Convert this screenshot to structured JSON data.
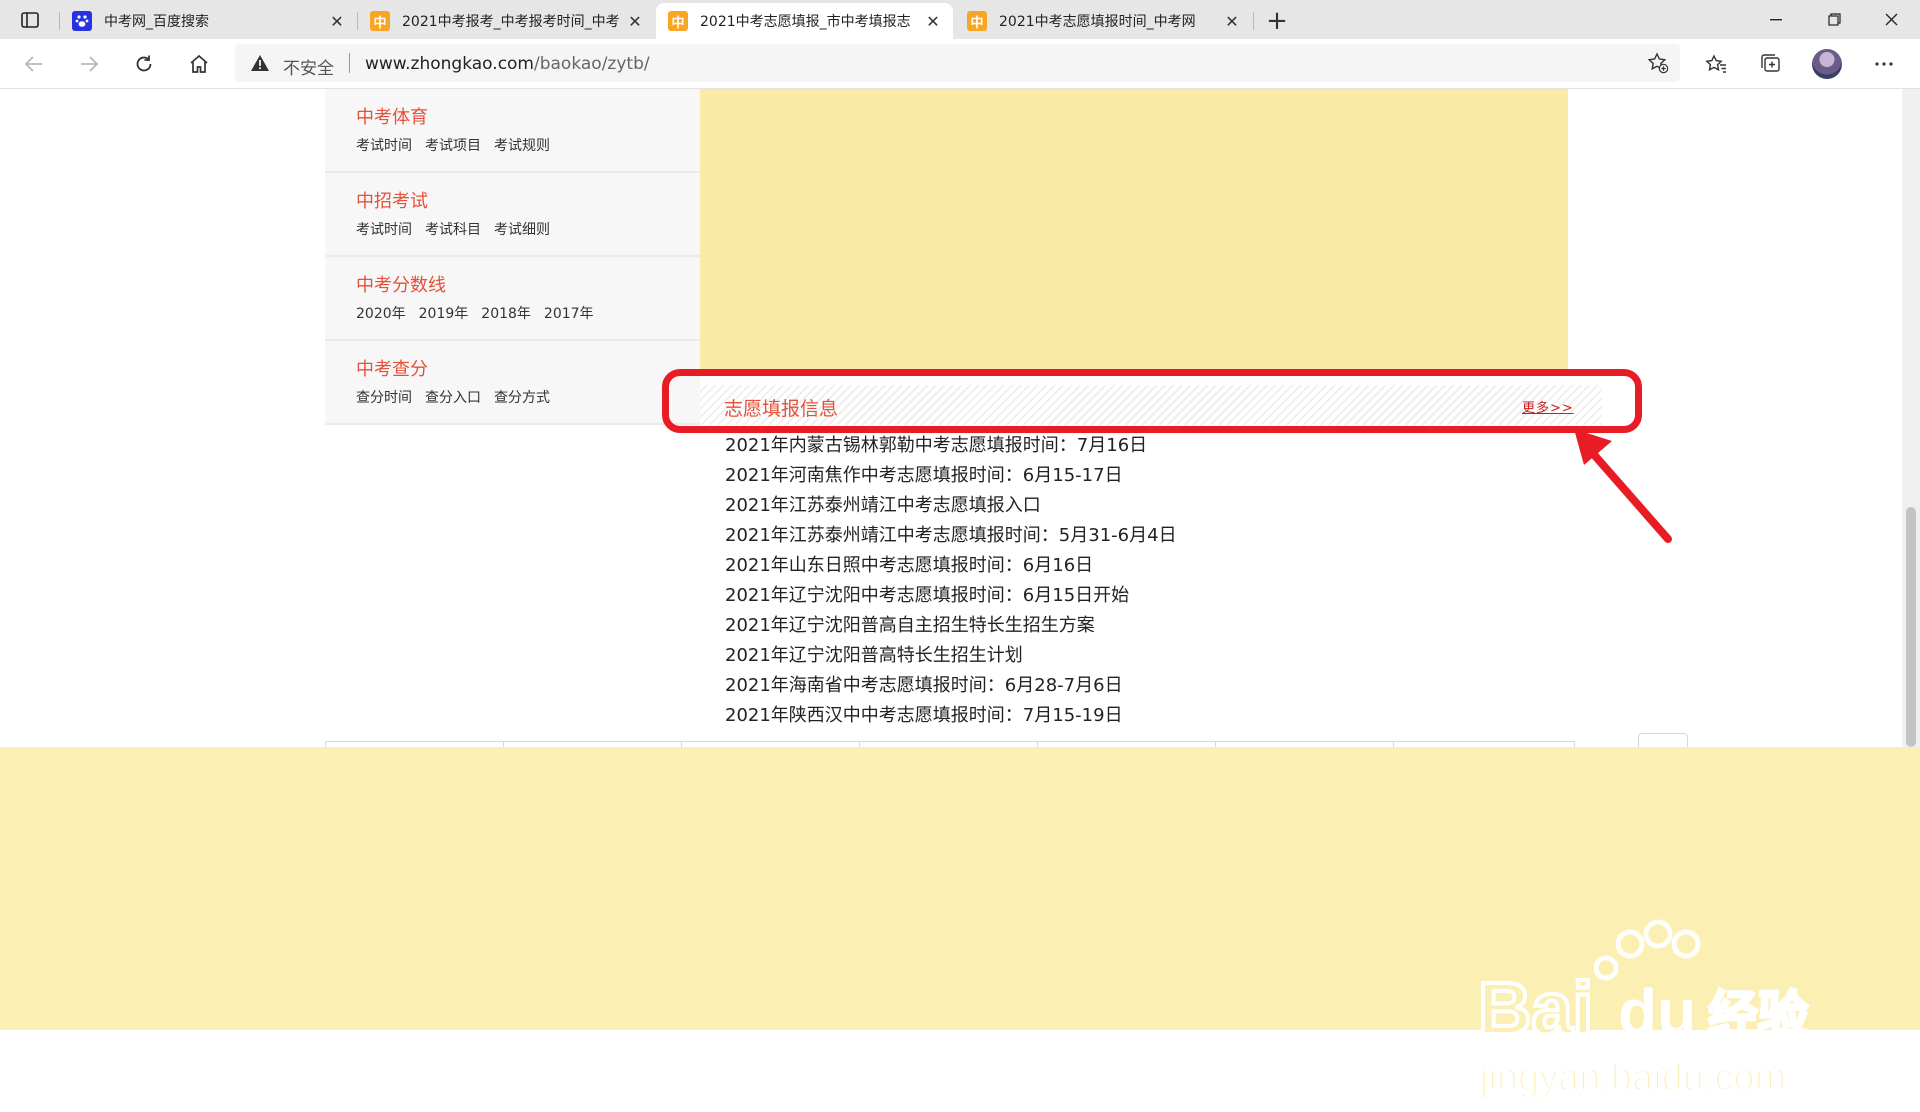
{
  "browser": {
    "tabs": [
      {
        "title": "中考网_百度搜索",
        "favicon": "baidu-paw-icon"
      },
      {
        "title": "2021中考报考_中考报考时间_中考",
        "favicon": "zhongkao-icon"
      },
      {
        "title": "2021中考志愿填报_市中考填报志",
        "favicon": "zhongkao-icon",
        "active": true
      },
      {
        "title": "2021中考志愿填报时间_中考网",
        "favicon": "zhongkao-icon"
      }
    ],
    "favicon_glyph": "中",
    "address": {
      "security_label": "不安全",
      "host": "www.zhongkao.com",
      "path": "/baokao/zytb/"
    }
  },
  "sidebar": {
    "items": [
      {
        "title": "中考体育",
        "links": [
          "考试时间",
          "考试项目",
          "考试规则"
        ]
      },
      {
        "title": "中招考试",
        "links": [
          "考试时间",
          "考试科目",
          "考试细则"
        ]
      },
      {
        "title": "中考分数线",
        "links": [
          "2020年",
          "2019年",
          "2018年",
          "2017年"
        ]
      },
      {
        "title": "中考查分",
        "links": [
          "查分时间",
          "查分入口",
          "查分方式"
        ]
      }
    ]
  },
  "info_section": {
    "title": "志愿填报信息",
    "more_label": "更多>>",
    "items": [
      "2021年内蒙古锡林郭勒中考志愿填报时间：7月16日",
      "2021年河南焦作中考志愿填报时间：6月15-17日",
      "2021年江苏泰州靖江中考志愿填报入口",
      "2021年江苏泰州靖江中考志愿填报时间：5月31-6月4日",
      "2021年山东日照中考志愿填报时间：6月16日",
      "2021年辽宁沈阳中考志愿填报时间：6月15日开始",
      "2021年辽宁沈阳普高自主招生特长生招生方案",
      "2021年辽宁沈阳普高特长生招生计划",
      "2021年海南省中考志愿填报时间：6月28-7月6日",
      "2021年陕西汉中中考志愿填报时间：7月15-19日"
    ]
  },
  "watermark": {
    "brand": "Bai",
    "brand_suffix": "du",
    "label": "经验",
    "url": "jingyan.baidu.com"
  },
  "colors": {
    "accent_red": "#e6513a",
    "highlight_red": "#e81c24",
    "panel_yellow": "#fbe9a6",
    "band_yellow": "#fcefb4"
  }
}
